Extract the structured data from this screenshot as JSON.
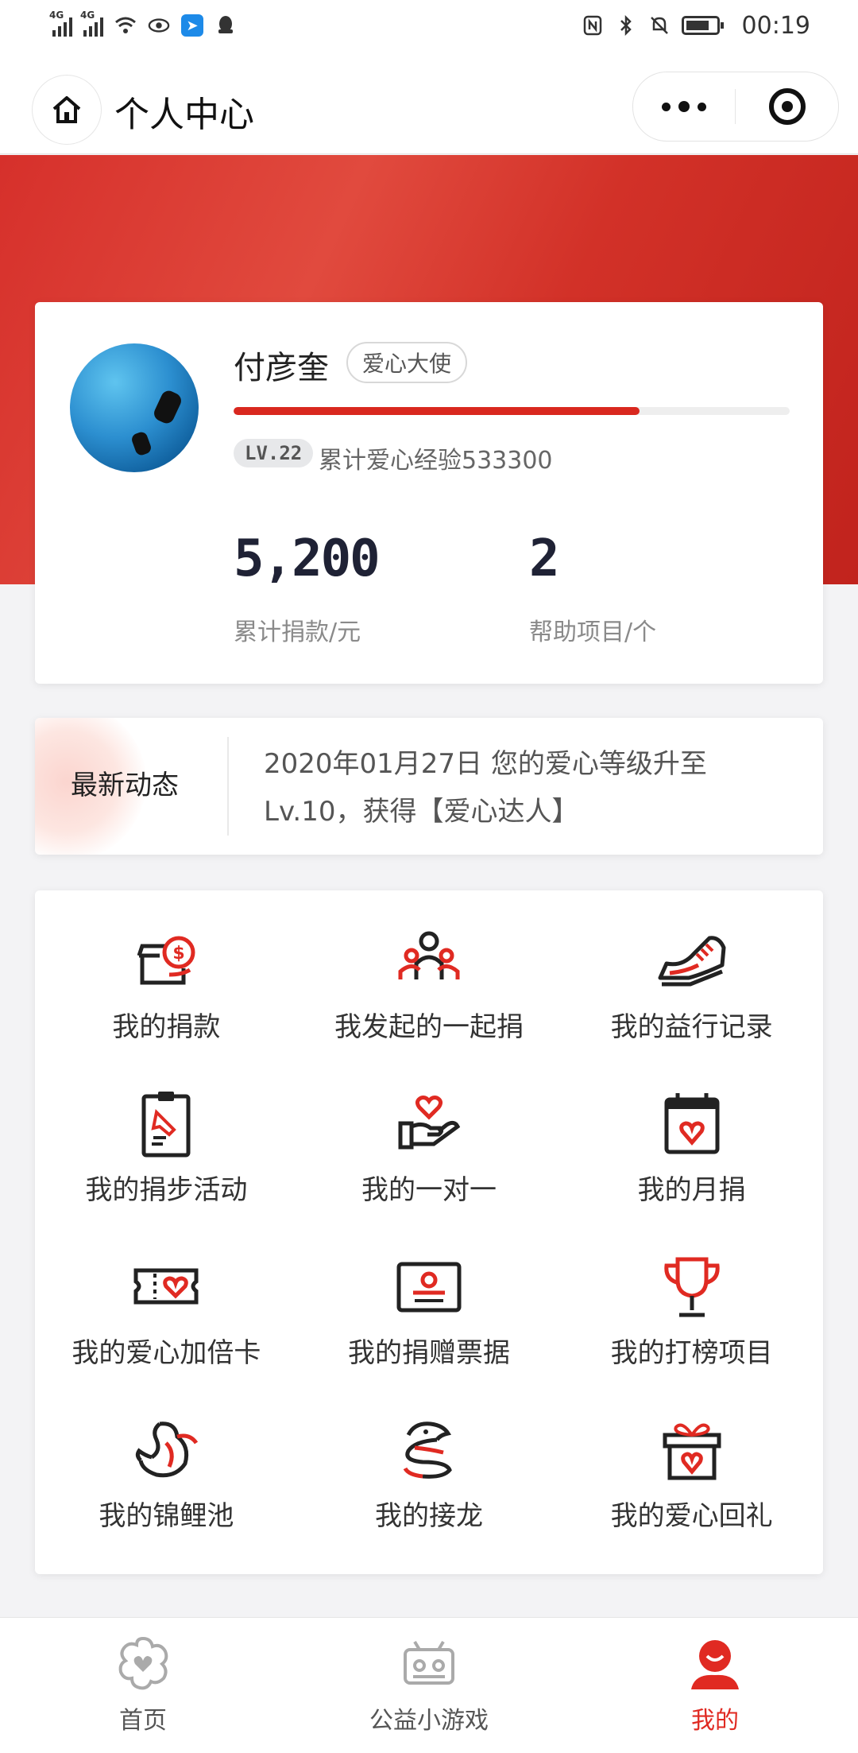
{
  "status_bar": {
    "time": "00:19",
    "network_1": "4G",
    "network_2": "4G"
  },
  "nav": {
    "title": "个人中心"
  },
  "profile": {
    "name": "付彦奎",
    "badge": "爱心大使",
    "level": "LV.22",
    "experience_text": "累计爱心经验533300",
    "progress_fraction": 0.73,
    "stats": [
      {
        "value": "5,200",
        "label": "累计捐款/元"
      },
      {
        "value": "2",
        "label": "帮助项目/个"
      }
    ]
  },
  "news": {
    "label": "最新动态",
    "text": "2020年01月27日 您的爱心等级升至Lv.10，获得【爱心达人】"
  },
  "menu": {
    "items": [
      {
        "label": "我的捐款",
        "icon": "donation-box-icon"
      },
      {
        "label": "我发起的一起捐",
        "icon": "group-people-icon"
      },
      {
        "label": "我的益行记录",
        "icon": "sneaker-icon"
      },
      {
        "label": "我的捐步活动",
        "icon": "clipboard-icon"
      },
      {
        "label": "我的一对一",
        "icon": "heart-hand-icon"
      },
      {
        "label": "我的月捐",
        "icon": "calendar-heart-icon"
      },
      {
        "label": "我的爱心加倍卡",
        "icon": "heart-ticket-icon"
      },
      {
        "label": "我的捐赠票据",
        "icon": "certificate-icon"
      },
      {
        "label": "我的打榜项目",
        "icon": "trophy-icon"
      },
      {
        "label": "我的锦鲤池",
        "icon": "koi-fish-icon"
      },
      {
        "label": "我的接龙",
        "icon": "dragon-icon"
      },
      {
        "label": "我的爱心回礼",
        "icon": "gift-heart-icon"
      }
    ]
  },
  "tabbar": {
    "tabs": [
      {
        "label": "首页",
        "icon": "flower-heart-icon",
        "active": false
      },
      {
        "label": "公益小游戏",
        "icon": "game-controller-icon",
        "active": false
      },
      {
        "label": "我的",
        "icon": "user-icon",
        "active": true
      }
    ]
  },
  "colors": {
    "accent": "#e02a22",
    "banner": "#d6302b",
    "text_dark": "#1f2235"
  }
}
